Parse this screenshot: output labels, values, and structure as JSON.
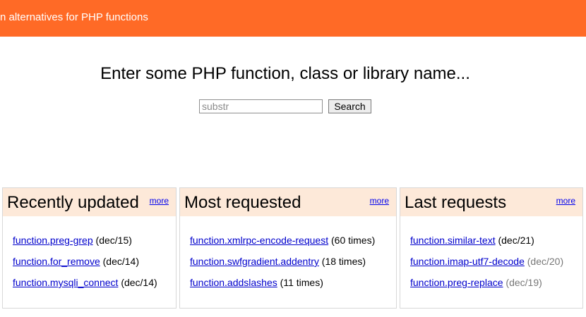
{
  "banner": {
    "text": "n alternatives for PHP functions"
  },
  "search": {
    "prompt": "Enter some PHP function, class or library name...",
    "placeholder": "substr",
    "button_label": "Search"
  },
  "panels": {
    "recent": {
      "title": "Recently updated",
      "more": "more",
      "items": [
        {
          "link": "function.preg-grep",
          "meta": "(dec/15)"
        },
        {
          "link": "function.for_remove",
          "meta": "(dec/14)"
        },
        {
          "link": "function.mysqli_connect",
          "meta": "(dec/14)"
        }
      ]
    },
    "requested": {
      "title": "Most requested",
      "more": "more",
      "items": [
        {
          "link": "function.xmlrpc-encode-request",
          "meta": "(60 times)"
        },
        {
          "link": "function.swfgradient.addentry",
          "meta": "(18 times)"
        },
        {
          "link": "function.addslashes",
          "meta": "(11 times)"
        }
      ]
    },
    "last": {
      "title": "Last requests",
      "more": "more",
      "items": [
        {
          "link": "function.similar-text",
          "meta": "(dec/21)"
        },
        {
          "link": "function.imap-utf7-decode",
          "meta": "(dec/20)"
        },
        {
          "link": "function.preg-replace",
          "meta": "(dec/19)"
        }
      ]
    }
  },
  "colors": {
    "banner": "#ff6a26",
    "panel_header": "#fde9d9",
    "link": "#0000cc"
  }
}
